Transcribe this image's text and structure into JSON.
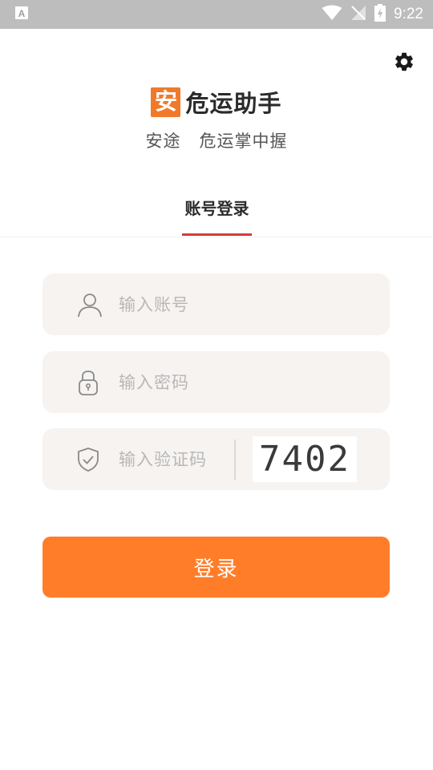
{
  "status_bar": {
    "time": "9:22",
    "left_icon": "a-notification-icon",
    "right_icons": [
      "wifi-icon",
      "no-signal-icon",
      "battery-charging-icon"
    ]
  },
  "header": {
    "settings_icon": "gear-icon",
    "logo_char": "安",
    "app_name": "危运助手",
    "slogan": "安途   危运掌中握"
  },
  "tabs": [
    {
      "label": "账号登录",
      "active": true
    }
  ],
  "form": {
    "account": {
      "placeholder": "输入账号",
      "value": "",
      "icon": "user-icon"
    },
    "password": {
      "placeholder": "输入密码",
      "value": "",
      "icon": "lock-icon"
    },
    "captcha": {
      "placeholder": "输入验证码",
      "value": "",
      "icon": "shield-check-icon",
      "image_text": "7402"
    }
  },
  "login_button": {
    "label": "登录"
  },
  "colors": {
    "primary": "#ff7d29",
    "logo": "#f07a2a",
    "tab_underline": "#d63a3a",
    "field_bg": "#f6f3f1",
    "status_bar": "#bdbdbd"
  }
}
